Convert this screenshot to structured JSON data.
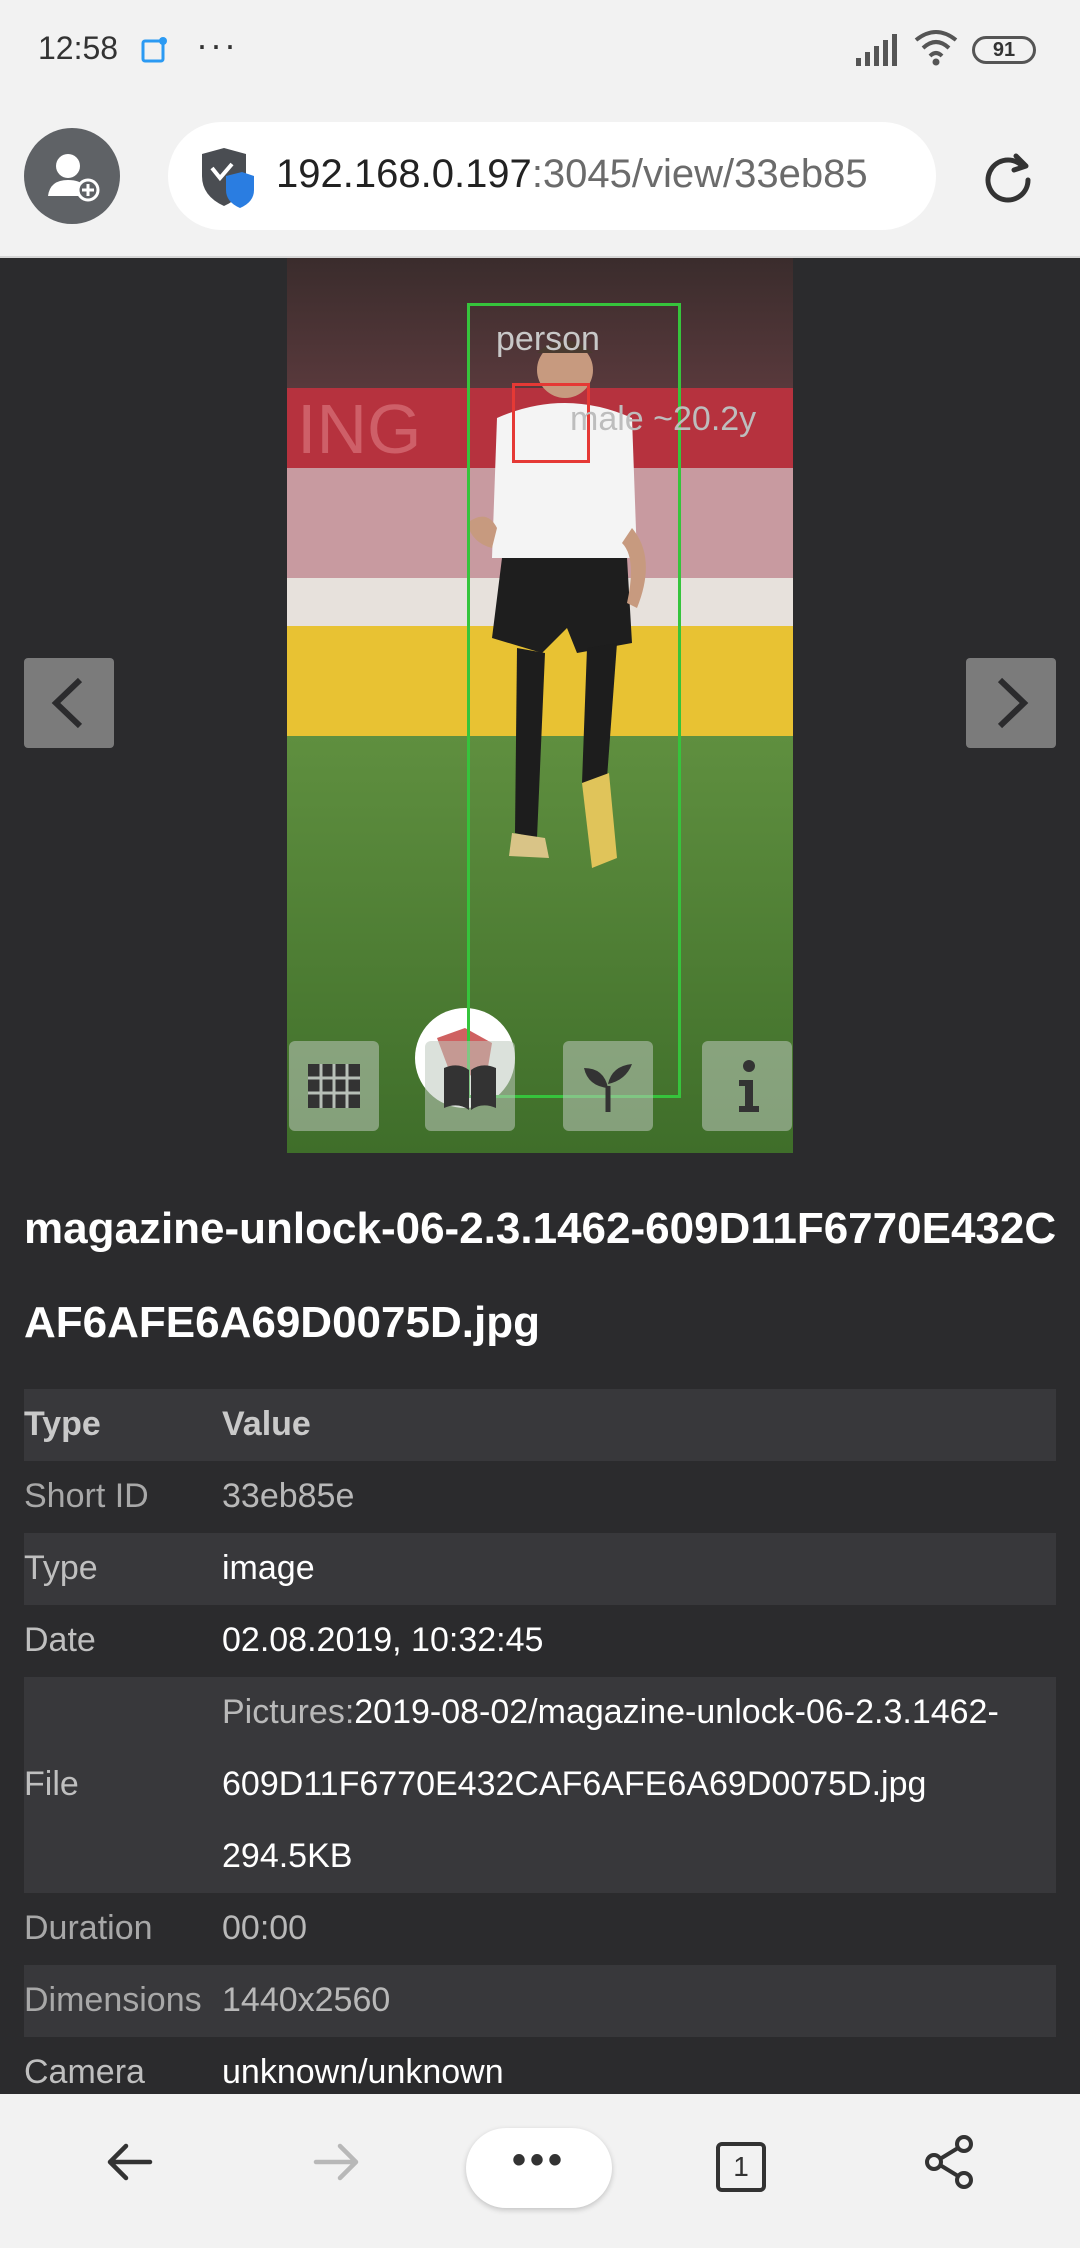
{
  "status_bar": {
    "time": "12:58",
    "battery": "91",
    "icons": [
      "note-icon",
      "more-dots-icon",
      "signal-icon",
      "wifi-icon",
      "battery-icon"
    ]
  },
  "browser": {
    "url_host": "192.168.0.197",
    "url_rest": ":3045/view/33eb85",
    "icons": [
      "add-user-icon",
      "shield-icon",
      "reload-icon"
    ]
  },
  "viewer": {
    "detections": [
      {
        "label": "person",
        "color": "#36c43c"
      },
      {
        "label": "male ~20.2y",
        "color": "#e53935"
      }
    ],
    "tools": [
      "grid-icon",
      "book-icon",
      "sprout-icon",
      "info-icon"
    ],
    "prev_icon": "chevron-left-icon",
    "next_icon": "chevron-right-icon"
  },
  "file_title": "magazine-unlock-06-2.3.1462-609D11F6770E432CAF6AFE6A69D0075D.jpg",
  "meta_table": {
    "header": {
      "type": "Type",
      "value": "Value"
    },
    "short_id": {
      "key": "Short ID",
      "value": "33eb85e"
    },
    "type": {
      "key": "Type",
      "value": "image"
    },
    "date": {
      "key": "Date",
      "value": "02.08.2019, 10:32:45"
    },
    "file": {
      "key": "File",
      "prefix": "Pictures:",
      "path_1": "2019-08-02/magazine-unlock-06-2.3.1462-",
      "path_2": "609D11F6770E432CAF6AFE6A69D0075D.jpg",
      "size": "294.5KB"
    },
    "duration": {
      "key": "Duration",
      "value": "00:00"
    },
    "dimensions": {
      "key": "Dimensions",
      "value": "1440x2560"
    },
    "camera": {
      "key": "Camera",
      "value": "unknown/unknown"
    }
  },
  "bottom_bar": {
    "tab_count": "1",
    "icons": [
      "back-arrow-icon",
      "forward-arrow-icon",
      "menu-icon",
      "tabs-icon",
      "share-icon"
    ]
  }
}
